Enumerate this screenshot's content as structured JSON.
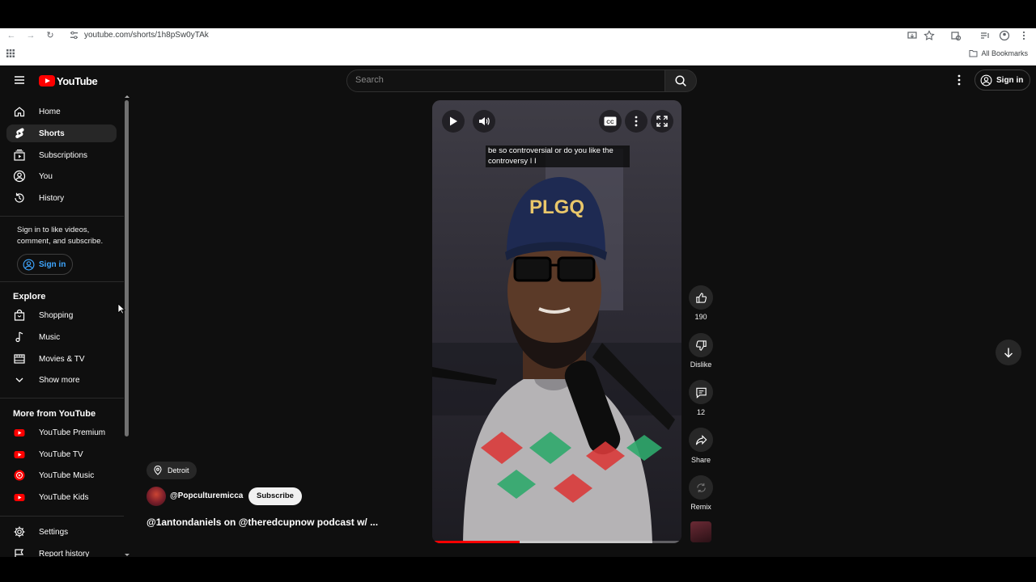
{
  "browser": {
    "url": "youtube.com/shorts/1h8pSw0yTAk",
    "bookmarks_label": "All Bookmarks"
  },
  "header": {
    "logo_text": "YouTube",
    "search_placeholder": "Search",
    "sign_in_label": "Sign in"
  },
  "sidebar": {
    "main_items": [
      {
        "label": "Home",
        "icon": "home-icon"
      },
      {
        "label": "Shorts",
        "icon": "shorts-icon",
        "active": true
      },
      {
        "label": "Subscriptions",
        "icon": "subscriptions-icon"
      },
      {
        "label": "You",
        "icon": "user-circle-icon"
      },
      {
        "label": "History",
        "icon": "history-icon"
      }
    ],
    "sign_in_prompt": "Sign in to like videos, comment, and subscribe.",
    "sign_in_label": "Sign in",
    "explore_title": "Explore",
    "explore_items": [
      {
        "label": "Shopping",
        "icon": "shopping-bag-icon"
      },
      {
        "label": "Music",
        "icon": "music-note-icon"
      },
      {
        "label": "Movies & TV",
        "icon": "film-icon"
      },
      {
        "label": "Show more",
        "icon": "chevron-down-icon"
      }
    ],
    "more_title": "More from YouTube",
    "more_items": [
      {
        "label": "YouTube Premium",
        "icon": "youtube-premium-icon"
      },
      {
        "label": "YouTube TV",
        "icon": "youtube-tv-icon"
      },
      {
        "label": "YouTube Music",
        "icon": "youtube-music-icon"
      },
      {
        "label": "YouTube Kids",
        "icon": "youtube-kids-icon"
      }
    ],
    "bottom_items": [
      {
        "label": "Settings",
        "icon": "gear-icon"
      },
      {
        "label": "Report history",
        "icon": "flag-icon"
      }
    ]
  },
  "player": {
    "caption": "be so controversial or do you like the controversy I I",
    "cap_text": "PLGQ",
    "progress": 0.35
  },
  "actions": {
    "like_count": "190",
    "dislike_label": "Dislike",
    "comment_count": "12",
    "share_label": "Share",
    "remix_label": "Remix"
  },
  "video_info": {
    "location": "Detroit",
    "channel": "@Popculturemicca",
    "subscribe_label": "Subscribe",
    "title": "@1antondaniels on @theredcupnow podcast w/ ..."
  },
  "colors": {
    "brand_red": "#ff0000",
    "link_blue": "#3ea6ff",
    "background": "#0f0f0f"
  }
}
